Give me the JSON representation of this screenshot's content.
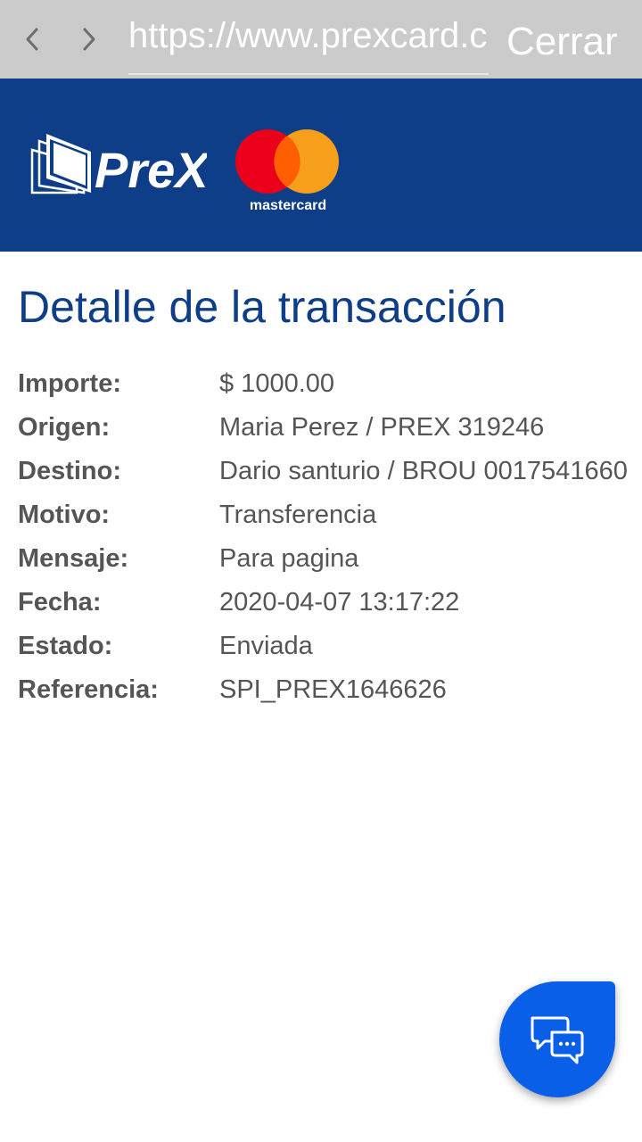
{
  "browser": {
    "url": "https://www.prexcard.com",
    "close_label": "Cerrar"
  },
  "brand": {
    "logo_text": "PreX",
    "mastercard_text": "mastercard"
  },
  "page": {
    "title": "Detalle de la transacción"
  },
  "details": [
    {
      "label": "Importe:",
      "value": "$ 1000.00"
    },
    {
      "label": "Origen:",
      "value": "Maria Perez / PREX 319246"
    },
    {
      "label": "Destino:",
      "value": "Dario santurio / BROU 0017541660"
    },
    {
      "label": "Motivo:",
      "value": "Transferencia"
    },
    {
      "label": "Mensaje:",
      "value": "Para pagina"
    },
    {
      "label": "Fecha:",
      "value": "2020-04-07 13:17:22"
    },
    {
      "label": "Estado:",
      "value": "Enviada"
    },
    {
      "label": "Referencia:",
      "value": "SPI_PREX1646626"
    }
  ],
  "icons": {
    "back": "chevron-left-icon",
    "forward": "chevron-right-icon",
    "chat": "chat-bubbles-icon"
  },
  "colors": {
    "brand_blue": "#0f3e88",
    "fab_blue": "#0a5fe8",
    "browser_bar": "#cbcbcb",
    "mc_red": "#eb001b",
    "mc_orange": "#f79e1b",
    "mc_overlap": "#ff5f00"
  }
}
